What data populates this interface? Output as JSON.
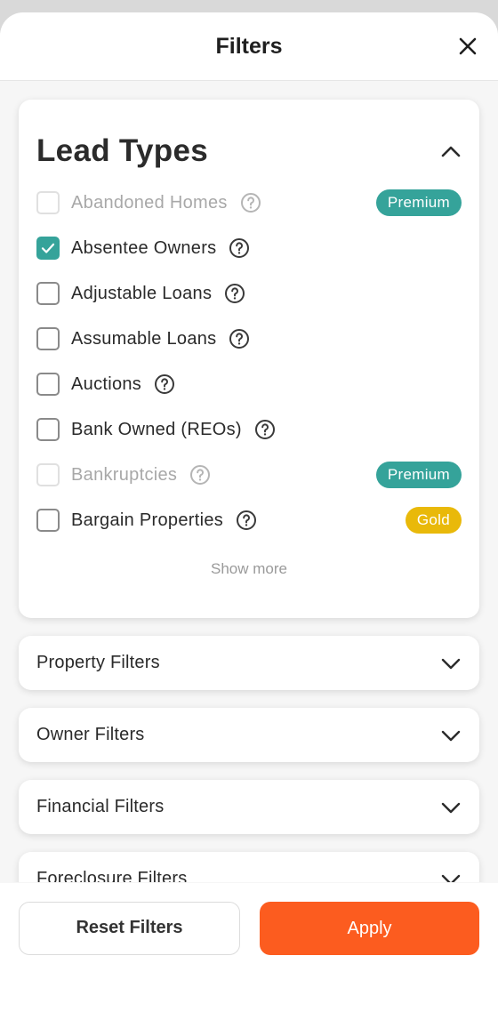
{
  "header": {
    "title": "Filters",
    "close_icon": "close-icon"
  },
  "lead_types": {
    "title": "Lead Types",
    "items": [
      {
        "label": "Abandoned Homes",
        "checked": false,
        "disabled": true,
        "badge": "Premium",
        "badge_type": "premium"
      },
      {
        "label": "Absentee Owners",
        "checked": true,
        "disabled": false,
        "badge": "",
        "badge_type": ""
      },
      {
        "label": "Adjustable Loans",
        "checked": false,
        "disabled": false,
        "badge": "",
        "badge_type": ""
      },
      {
        "label": "Assumable Loans",
        "checked": false,
        "disabled": false,
        "badge": "",
        "badge_type": ""
      },
      {
        "label": "Auctions",
        "checked": false,
        "disabled": false,
        "badge": "",
        "badge_type": ""
      },
      {
        "label": "Bank Owned (REOs)",
        "checked": false,
        "disabled": false,
        "badge": "",
        "badge_type": ""
      },
      {
        "label": "Bankruptcies",
        "checked": false,
        "disabled": true,
        "badge": "Premium",
        "badge_type": "premium"
      },
      {
        "label": "Bargain Properties",
        "checked": false,
        "disabled": false,
        "badge": "Gold",
        "badge_type": "gold"
      }
    ],
    "show_more": "Show more"
  },
  "sections": [
    {
      "label": "Property Filters"
    },
    {
      "label": "Owner Filters"
    },
    {
      "label": "Financial Filters"
    },
    {
      "label": "Foreclosure Filters"
    }
  ],
  "footer": {
    "reset_label": "Reset Filters",
    "apply_label": "Apply"
  },
  "colors": {
    "accent": "#35a39a",
    "gold": "#e9b90a",
    "apply": "#fc5c1f"
  }
}
